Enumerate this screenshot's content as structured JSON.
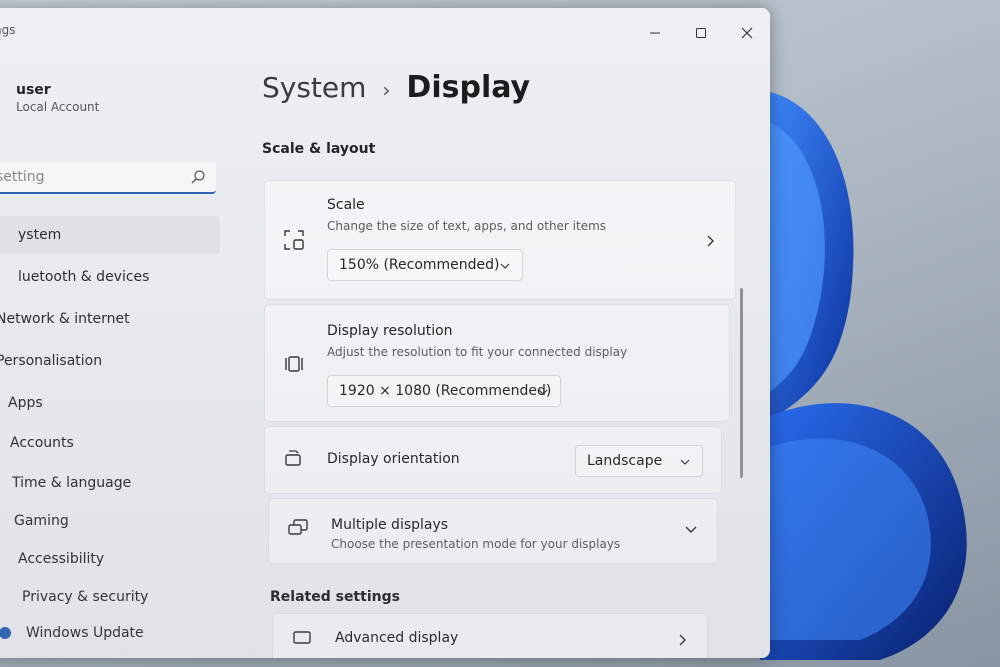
{
  "window": {
    "app_title": "ngs",
    "minimize_label": "—",
    "maximize_label": "☐",
    "close_label": "✕"
  },
  "user": {
    "name": "user",
    "account_type": "Local Account"
  },
  "search": {
    "placeholder": "setting"
  },
  "nav": {
    "items": [
      {
        "label": "ystem",
        "active": true
      },
      {
        "label": "luetooth & devices"
      },
      {
        "label": "Network & internet"
      },
      {
        "label": "Personalisation"
      },
      {
        "label": "Apps"
      },
      {
        "label": "Accounts"
      },
      {
        "label": "Time & language"
      },
      {
        "label": "Gaming"
      },
      {
        "label": "Accessibility"
      },
      {
        "label": "Privacy & security"
      },
      {
        "label": "Windows Update"
      }
    ]
  },
  "breadcrumb": {
    "parent": "System",
    "separator": "›",
    "current": "Display"
  },
  "sections": {
    "scale_layout": "Scale & layout",
    "related": "Related settings"
  },
  "scale": {
    "title": "Scale",
    "description": "Change the size of text, apps, and other items",
    "value": "150% (Recommended)",
    "icon": "scale-icon"
  },
  "resolution": {
    "title": "Display resolution",
    "description": "Adjust the resolution to fit your connected display",
    "value": "1920 × 1080 (Recommended)",
    "icon": "resolution-icon"
  },
  "orientation": {
    "title": "Display orientation",
    "value": "Landscape",
    "icon": "orientation-icon"
  },
  "multiple": {
    "title": "Multiple displays",
    "description": "Choose the presentation mode for your displays",
    "icon": "multiple-displays-icon"
  },
  "advanced": {
    "title": "Advanced display",
    "icon": "monitor-icon"
  },
  "colors": {
    "accent": "#2b61b5",
    "wallpaper_blue": "#1f5fd6"
  }
}
